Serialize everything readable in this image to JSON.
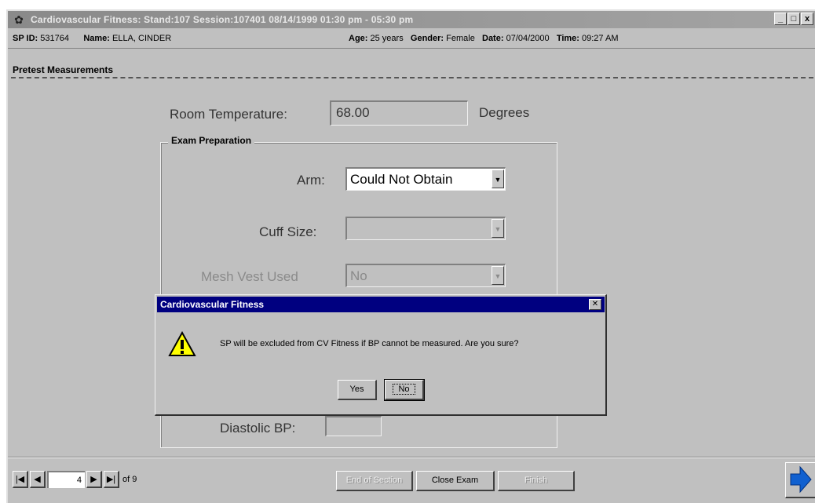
{
  "window": {
    "title": "Cardiovascular Fitness: Stand:107 Session:107401 08/14/1999 01:30 pm - 05:30 pm",
    "controls": {
      "minimize": "_",
      "maximize": "□",
      "close": "x"
    }
  },
  "header": {
    "sp_id_label": "SP ID:",
    "sp_id": "531764",
    "name_label": "Name:",
    "name": "ELLA, CINDER",
    "age_label": "Age:",
    "age": "25 years",
    "gender_label": "Gender:",
    "gender": "Female",
    "date_label": "Date:",
    "date": "07/04/2000",
    "time_label": "Time:",
    "time": "09:27 AM"
  },
  "section": {
    "title": "Pretest Measurements"
  },
  "form": {
    "room_temp_label": "Room Temperature:",
    "room_temp_value": "68.00",
    "room_temp_unit": "Degrees",
    "group_title": "Exam Preparation",
    "arm_label": "Arm:",
    "arm_value": "Could Not Obtain",
    "cuff_size_label": "Cuff Size:",
    "cuff_size_value": "",
    "mesh_vest_label": "Mesh Vest Used",
    "mesh_vest_value": "No",
    "diastolic_label": "Diastolic BP:",
    "diastolic_value": ""
  },
  "footer": {
    "page_current": "4",
    "page_total_text": "of 9",
    "end_section_label": "End of Section",
    "close_exam_label": "Close Exam",
    "finish_label": "Finish"
  },
  "dialog": {
    "title": "Cardiovascular Fitness",
    "message": "SP will be excluded from CV Fitness if BP cannot be measured. Are you sure?",
    "yes_label": "Yes",
    "no_label": "No"
  },
  "colors": {
    "window_bg": "#c0c0c0",
    "dialog_title_bg": "#000080",
    "warning_icon": "#ffff00",
    "next_arrow": "#1060d0"
  },
  "icons": [
    "app-icon",
    "warning-icon",
    "first-page-icon",
    "prev-page-icon",
    "next-page-icon",
    "last-page-icon",
    "next-arrow-icon"
  ]
}
